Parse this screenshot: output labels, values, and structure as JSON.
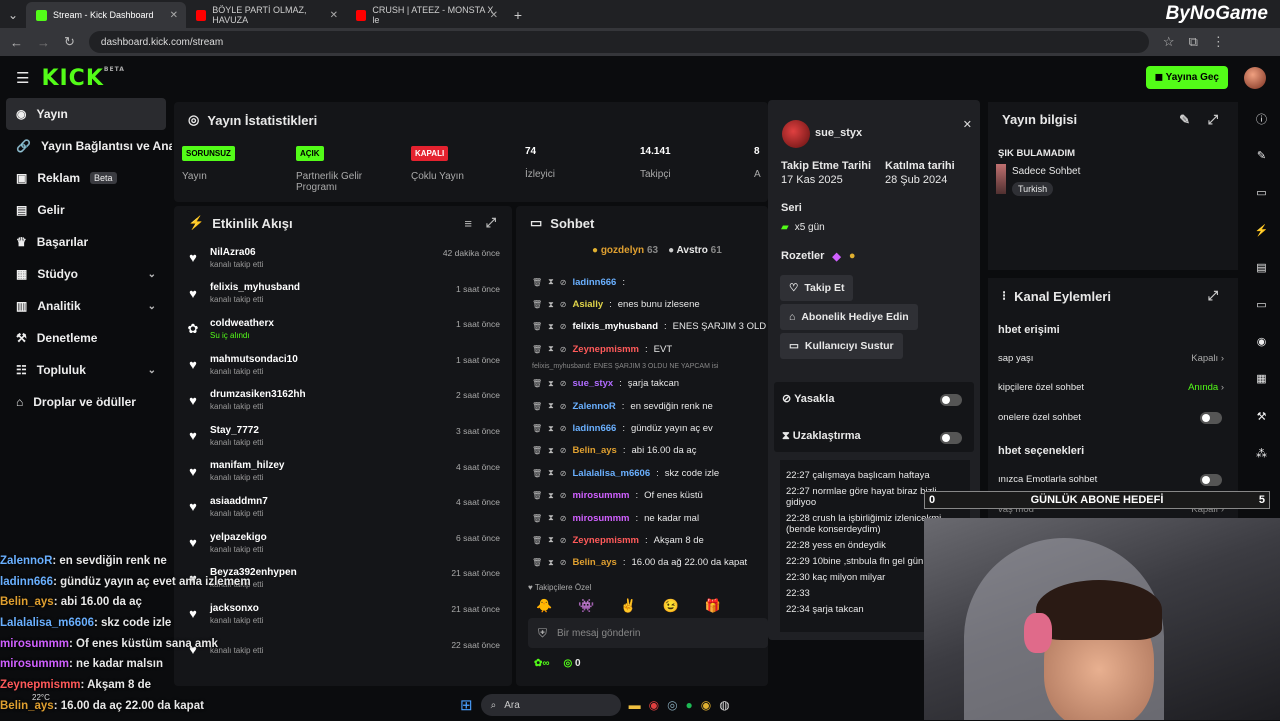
{
  "browser": {
    "tabs": [
      {
        "label": "Stream - Kick Dashboard",
        "color": "#53fc18"
      },
      {
        "label": "BÖYLE PARTİ OLMAZ, HAVUZA",
        "color": "#ff0000"
      },
      {
        "label": "CRUSH | ATEEZ - MONSTA X le",
        "color": "#ff0000"
      }
    ],
    "url": "dashboard.kick.com/stream",
    "watermark": "ByNoGame"
  },
  "header": {
    "logo": "KICK",
    "beta": "BETA",
    "go_live": "Yayına Geç"
  },
  "sidebar": {
    "items": [
      {
        "label": "Yayın",
        "icon": "circle-icon"
      },
      {
        "label": "Yayın Bağlantısı ve Anahtar",
        "icon": "link-icon"
      },
      {
        "label": "Reklam",
        "icon": "ad-icon",
        "badge": "Beta"
      },
      {
        "label": "Gelir",
        "icon": "money-icon"
      },
      {
        "label": "Başarılar",
        "icon": "trophy-icon"
      },
      {
        "label": "Stüdyo",
        "icon": "studio-icon",
        "chev": "⌄"
      },
      {
        "label": "Analitik",
        "icon": "chart-icon",
        "chev": "⌄"
      },
      {
        "label": "Denetleme",
        "icon": "hammer-icon"
      },
      {
        "label": "Topluluk",
        "icon": "community-icon",
        "chev": "⌄"
      },
      {
        "label": "Droplar ve ödüller",
        "icon": "gift-icon"
      }
    ]
  },
  "stats": {
    "title": "Yayın İstatistikleri",
    "items": [
      {
        "tag": "SORUNSUZ",
        "tag_color": "#53fc18",
        "label": "Yayın"
      },
      {
        "tag": "AÇIK",
        "tag_color": "#53fc18",
        "label": "Partnerlik Gelir Programı"
      },
      {
        "tag": "KAPALI",
        "tag_color": "#e5222f",
        "label": "Çoklu Yayın"
      },
      {
        "num": "74",
        "label": "İzleyici"
      },
      {
        "num": "14.141",
        "label": "Takipçi"
      },
      {
        "num": "8",
        "label": "A"
      }
    ]
  },
  "activity": {
    "title": "Etkinlik Akışı",
    "events": [
      {
        "name": "NilAzra06",
        "sub": "kanalı takip etti",
        "time": "42 dakika önce",
        "icon": "♥"
      },
      {
        "name": "felixis_myhusband",
        "sub": "kanalı takip etti",
        "time": "1 saat önce",
        "icon": "♥"
      },
      {
        "name": "coldweatherx",
        "sub": "Su iç alındı",
        "time": "1 saat önce",
        "icon": "✿",
        "green": true
      },
      {
        "name": "mahmutsondaci10",
        "sub": "kanalı takip etti",
        "time": "1 saat önce",
        "icon": "♥"
      },
      {
        "name": "drumzasiken3162hh",
        "sub": "kanalı takip etti",
        "time": "2 saat önce",
        "icon": "♥"
      },
      {
        "name": "Stay_7772",
        "sub": "kanalı takip etti",
        "time": "3 saat önce",
        "icon": "♥"
      },
      {
        "name": "manifam_hilzey",
        "sub": "kanalı takip etti",
        "time": "4 saat önce",
        "icon": "♥"
      },
      {
        "name": "asiaaddmn7",
        "sub": "kanalı takip etti",
        "time": "4 saat önce",
        "icon": "♥"
      },
      {
        "name": "yelpazekigo",
        "sub": "kanalı takip etti",
        "time": "6 saat önce",
        "icon": "♥"
      },
      {
        "name": "Beyza392enhypen",
        "sub": "kanalı takip etti",
        "time": "21 saat önce",
        "icon": "♥"
      },
      {
        "name": "jacksonxo",
        "sub": "kanalı takip etti",
        "time": "21 saat önce",
        "icon": "♥"
      },
      {
        "name": "",
        "sub": "kanalı takip etti",
        "time": "22 saat önce",
        "icon": "♥"
      }
    ]
  },
  "chat": {
    "title": "Sohbet",
    "top": [
      {
        "name": "gozdelyn",
        "count": "63"
      },
      {
        "name": "Avstro",
        "count": "61"
      }
    ],
    "messages": [
      {
        "user": "ladinn666",
        "color": "#6ab0ff",
        "text": ""
      },
      {
        "user": "Asially",
        "color": "#e0d44a",
        "text": "enes bunu izlesene"
      },
      {
        "user": "felixis_myhusband",
        "color": "#ffffff",
        "text": "ENES ŞARJIM 3 OLD"
      },
      {
        "user": "Zeynepmismm",
        "color": "#ff5a5a",
        "text": "EVT"
      },
      {
        "user": "sue_styx",
        "color": "#b06bff",
        "text": "şarja takcan",
        "note": "felixis_myhusband: ENES ŞARJIM 3 OLDU NE YAPCAM isi"
      },
      {
        "user": "ZalennoR",
        "color": "#6ab0ff",
        "text": "en sevdiğin renk ne"
      },
      {
        "user": "ladinn666",
        "color": "#6ab0ff",
        "text": "gündüz yayın aç ev"
      },
      {
        "user": "Belin_ays",
        "color": "#e0a030",
        "text": "abi 16.00 da aç"
      },
      {
        "user": "Lalalalisa_m6606",
        "color": "#6ab0ff",
        "text": "skz code izle"
      },
      {
        "user": "mirosummm",
        "color": "#d060ff",
        "text": "Of enes küstü"
      },
      {
        "user": "mirosummm",
        "color": "#d060ff",
        "text": "ne kadar mal"
      },
      {
        "user": "Zeynepmismm",
        "color": "#ff5a5a",
        "text": "Akşam 8 de"
      },
      {
        "user": "Belin_ays",
        "color": "#e0a030",
        "text": "16.00 da ağ 22.00 da kapat"
      }
    ],
    "followers_only": "Takipçilere Özel",
    "placeholder": "Bir mesaj gönderin",
    "viewer_count": "0"
  },
  "user_card": {
    "username": "sue_styx",
    "follow_label": "Takip Etme Tarihi",
    "follow_date": "17 Kas 2025",
    "join_label": "Katılma tarihi",
    "join_date": "28 Şub 2024",
    "streak_label": "Seri",
    "streak_value": "x5 gün",
    "badges_label": "Rozetler",
    "btn_follow": "Takip Et",
    "btn_gift": "Abonelik Hediye Edin",
    "btn_mute": "Kullanıcıyı Sustur",
    "ban_label": "Yasakla",
    "timeout_label": "Uzaklaştırma",
    "log": [
      {
        "time": "22:27",
        "text": "çalışmaya başlıcam haftaya"
      },
      {
        "time": "22:27",
        "text": "normlae göre hayat biraz bizli gidiyoo"
      },
      {
        "time": "22:28",
        "text": "crush la işbirliğimiz izlenicekmi (bende konserdeydim)"
      },
      {
        "time": "22:28",
        "text": "yess en öndeydik"
      },
      {
        "time": "22:29",
        "text": "10bine ,stnbula fln gel gün abla"
      },
      {
        "time": "22:30",
        "text": "kaç milyon milyar"
      },
      {
        "time": "22:33",
        "text": ""
      },
      {
        "time": "22:34",
        "text": "şarja takcan"
      }
    ]
  },
  "stream_info": {
    "title": "Yayın bilgisi",
    "stream_title": "ŞIK BULAMADIM",
    "category": "Sadece Sohbet",
    "language": "Turkish"
  },
  "channel_actions": {
    "title": "Kanal Eylemleri",
    "access_title": "hbet erişimi",
    "rows": [
      {
        "label": "sap yaşı",
        "value": "Kapalı"
      },
      {
        "label": "kipçilere özel sohbet",
        "value": "Anında",
        "green": true
      },
      {
        "label": "onelere özel sohbet",
        "value": ""
      }
    ],
    "options_title": "hbet seçenekleri",
    "options_rows": [
      {
        "label": "ınızca Emotlarla sohbet"
      },
      {
        "label": "vaş mod",
        "value": "Kapalı"
      }
    ]
  },
  "goal": {
    "label": "GÜNLÜK ABONE HEDEFİ",
    "left": "0",
    "right": "5"
  },
  "overlay_chat": [
    {
      "user": "ZalennoR",
      "color": "#6ab0ff",
      "text": ": en sevdiğin renk ne"
    },
    {
      "user": "ladinn666",
      "color": "#6ab0ff",
      "text": ": gündüz yayın aç evet ama izlemem"
    },
    {
      "user": "Belin_ays",
      "color": "#e0a030",
      "text": ": abi 16.00 da aç"
    },
    {
      "user": "Lalalalisa_m6606",
      "color": "#6ab0ff",
      "text": ": skz code izle"
    },
    {
      "user": "mirosummm",
      "color": "#d060ff",
      "text": ": Of enes küstüm sana amk"
    },
    {
      "user": "mirosummm",
      "color": "#d060ff",
      "text": ": ne kadar malsın"
    },
    {
      "user": "Zeynepmismm",
      "color": "#ff5a5a",
      "text": ": Akşam 8 de"
    },
    {
      "user": "Belin_ays",
      "color": "#e0a030",
      "text": ": 16.00 da aç 22.00 da kapat"
    }
  ],
  "taskbar": {
    "search": "Ara",
    "weather": "22°C"
  }
}
